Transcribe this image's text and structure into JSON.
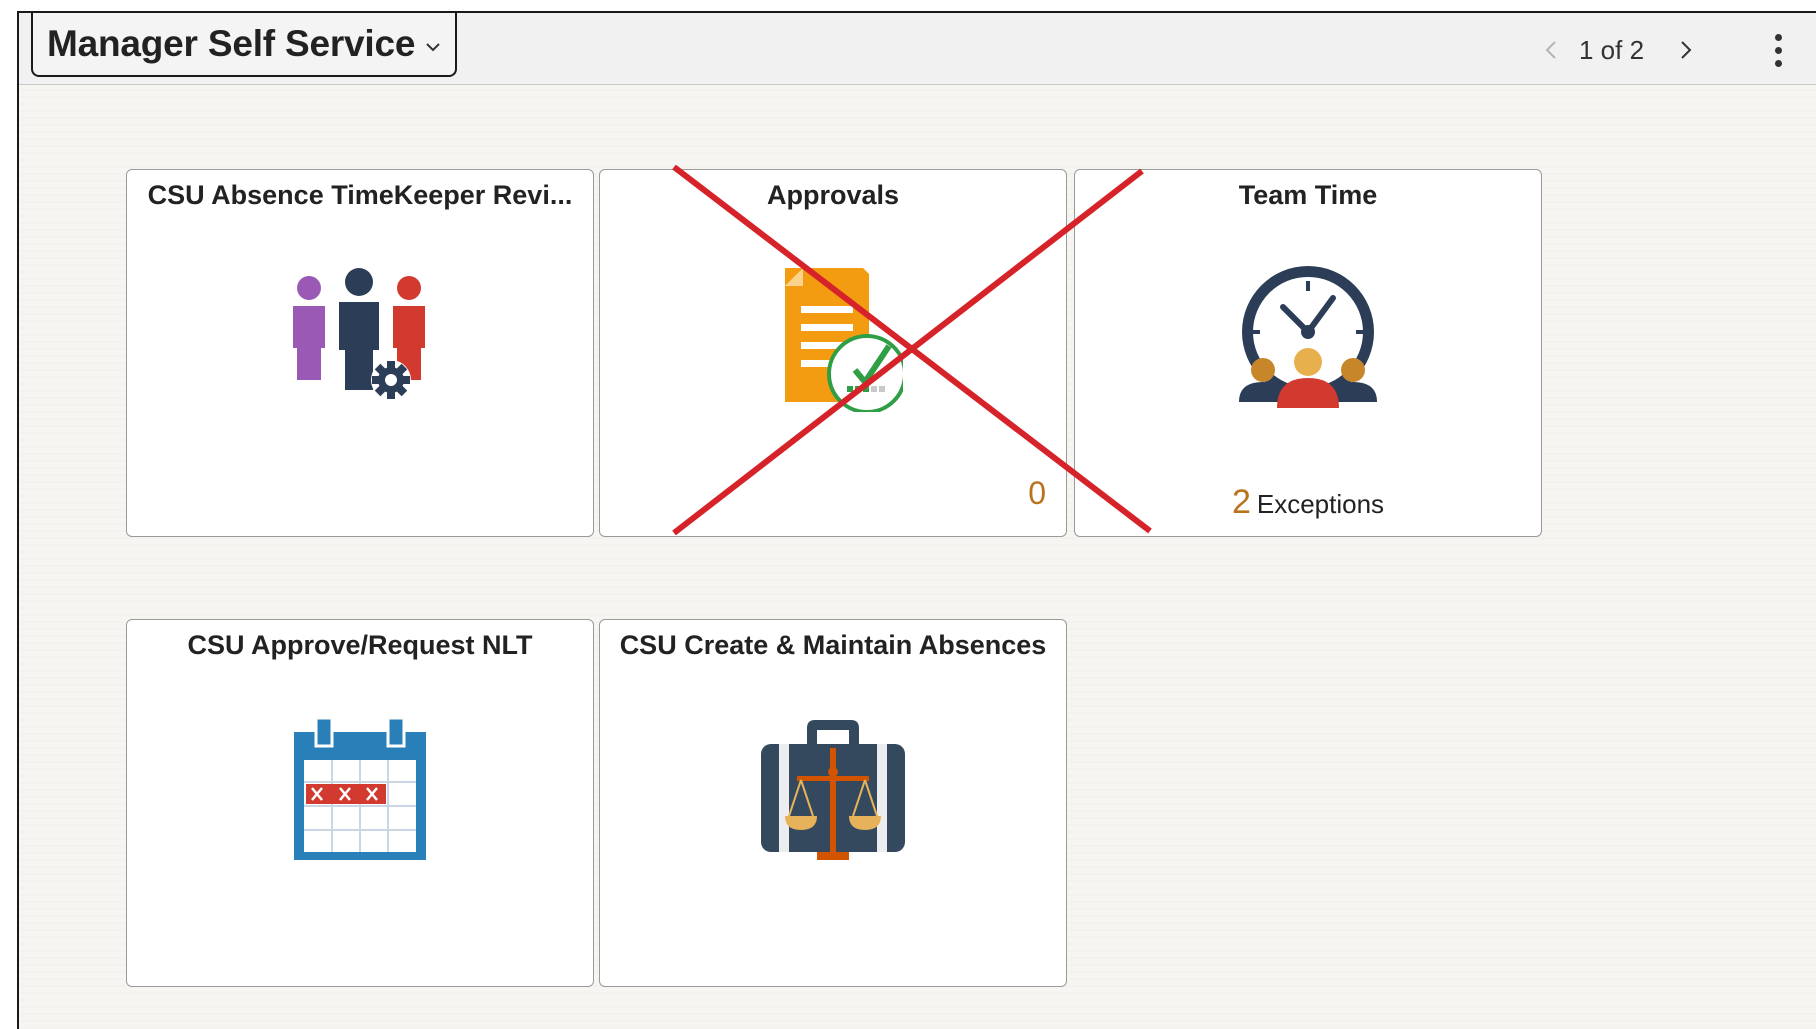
{
  "header": {
    "title": "Manager Self Service",
    "pager_text": "1 of 2"
  },
  "tiles": [
    {
      "title": "CSU Absence TimeKeeper Revi...",
      "icon": "people-gear-icon"
    },
    {
      "title": "Approvals",
      "icon": "document-approval-icon",
      "count": "0",
      "crossed_out": true
    },
    {
      "title": "Team Time",
      "icon": "team-clock-icon",
      "count": "2",
      "count_label": "Exceptions"
    },
    {
      "title": "CSU Approve/Request NLT",
      "icon": "calendar-icon"
    },
    {
      "title": "CSU Create & Maintain Absences",
      "icon": "briefcase-scales-icon"
    }
  ],
  "colors": {
    "count": "#b8731e",
    "cross": "#d6232a"
  }
}
